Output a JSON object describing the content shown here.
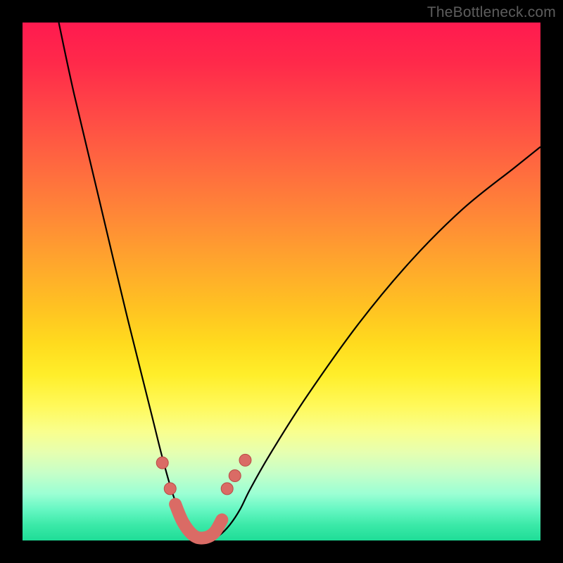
{
  "watermark": {
    "text": "TheBottleneck.com"
  },
  "chart_data": {
    "type": "line",
    "title": "",
    "xlabel": "",
    "ylabel": "",
    "xlim": [
      0,
      100
    ],
    "ylim": [
      0,
      100
    ],
    "series": [
      {
        "name": "bottleneck-curve",
        "x": [
          7,
          10,
          15,
          20,
          25,
          27,
          29,
          31,
          33,
          34,
          35,
          36,
          38,
          40,
          42,
          44,
          48,
          55,
          65,
          75,
          85,
          95,
          100
        ],
        "y": [
          100,
          86,
          65,
          44,
          24,
          16,
          9,
          4,
          1,
          0,
          0,
          0,
          1,
          3,
          6,
          10,
          17,
          28,
          42,
          54,
          64,
          72,
          76
        ]
      }
    ],
    "markers": [
      {
        "name": "dot-left-1",
        "x": 27.0,
        "y": 15.0
      },
      {
        "name": "dot-left-2",
        "x": 28.5,
        "y": 10.0
      },
      {
        "name": "dot-right-1",
        "x": 39.5,
        "y": 10.0
      },
      {
        "name": "dot-right-2",
        "x": 41.0,
        "y": 12.5
      },
      {
        "name": "dot-right-3",
        "x": 43.0,
        "y": 15.5
      }
    ],
    "worm": [
      {
        "x": 29.5,
        "y": 7.0
      },
      {
        "x": 31.0,
        "y": 3.5
      },
      {
        "x": 33.0,
        "y": 1.0
      },
      {
        "x": 35.0,
        "y": 0.5
      },
      {
        "x": 37.0,
        "y": 1.5
      },
      {
        "x": 38.5,
        "y": 4.0
      }
    ],
    "colors": {
      "curve": "#000000",
      "marker_fill": "#da6b65",
      "marker_stroke": "#b94b45"
    }
  }
}
